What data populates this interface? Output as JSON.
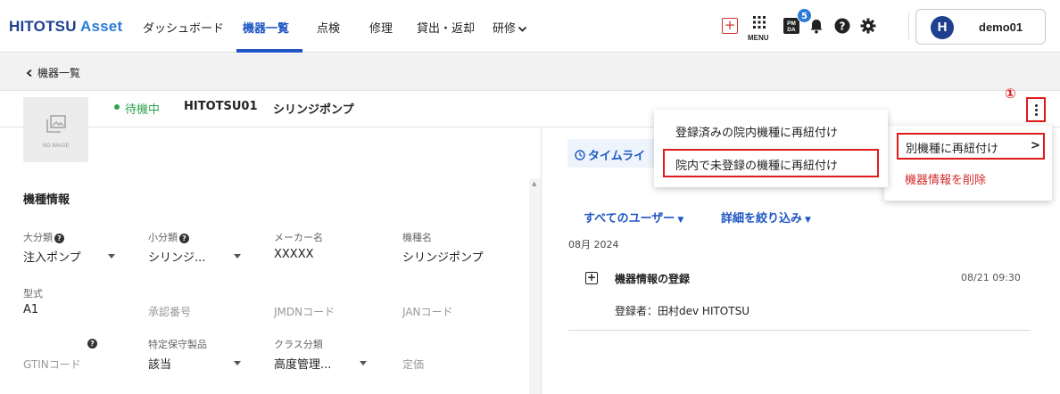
{
  "header": {
    "logo_main": "HITOTSU",
    "logo_sub": "Asset",
    "nav": [
      {
        "label": "ダッシュボード"
      },
      {
        "label": "機器一覧",
        "active": true
      },
      {
        "label": "点検"
      },
      {
        "label": "修理"
      },
      {
        "label": "貸出・返却"
      },
      {
        "label": "研修"
      }
    ],
    "menu_label": "MENU",
    "notification_badge": "5",
    "pmda_label": "PM DA",
    "user_initial": "H",
    "username": "demo01",
    "icons": [
      "plus-square-icon",
      "grid-menu-icon",
      "pmda-icon",
      "bell-icon",
      "help-icon",
      "gear-icon"
    ]
  },
  "breadcrumb": {
    "back_label": "機器一覧"
  },
  "asset": {
    "no_image_label": "NO IMAGE",
    "status": "待機中",
    "status_color": "#2ea44f",
    "code": "HITOTSU01",
    "name": "シリンジポンプ",
    "step_marker": "①"
  },
  "model_info": {
    "section_title": "機種情報",
    "fields": {
      "major_category": {
        "label": "大分類",
        "value": "注入ポンプ"
      },
      "minor_category": {
        "label": "小分類",
        "value": "シリンジ..."
      },
      "maker": {
        "label": "メーカー名",
        "value": "XXXXX"
      },
      "model_name": {
        "label": "機種名",
        "value": "シリンジポンプ"
      },
      "model_number": {
        "label": "型式",
        "value": "A1"
      },
      "approval_number": {
        "placeholder": "承認番号"
      },
      "jmdn_code": {
        "placeholder": "JMDNコード"
      },
      "jan_code": {
        "placeholder": "JANコード"
      },
      "gtin_code": {
        "placeholder": "GTINコード"
      },
      "special_maintenance": {
        "label": "特定保守製品",
        "value": "該当"
      },
      "class": {
        "label": "クラス分類",
        "value": "高度管理..."
      },
      "price": {
        "placeholder": "定価"
      }
    }
  },
  "timeline": {
    "tab_label": "タイムライ",
    "filter_users": "すべてのユーザー",
    "filter_detail": "詳細を絞り込み",
    "month": "08月 2024",
    "events": [
      {
        "title": "機器情報の登録",
        "time": "08/21 09:30",
        "by": "登録者：田村dev HITOTSU"
      }
    ]
  },
  "context_menu": {
    "rebind_label": "別機種に再紐付け",
    "delete_label": "機器情報を削除",
    "delete_color": "#d42a2a",
    "submenu": [
      {
        "label": "登録済みの院内機種に再紐付け"
      },
      {
        "label": "院内で未登録の機種に再紐付け",
        "highlighted": true
      }
    ]
  },
  "colors": {
    "brand": "#1f3f8f",
    "accent": "#1f56c4",
    "highlight": "#e01b1b"
  }
}
